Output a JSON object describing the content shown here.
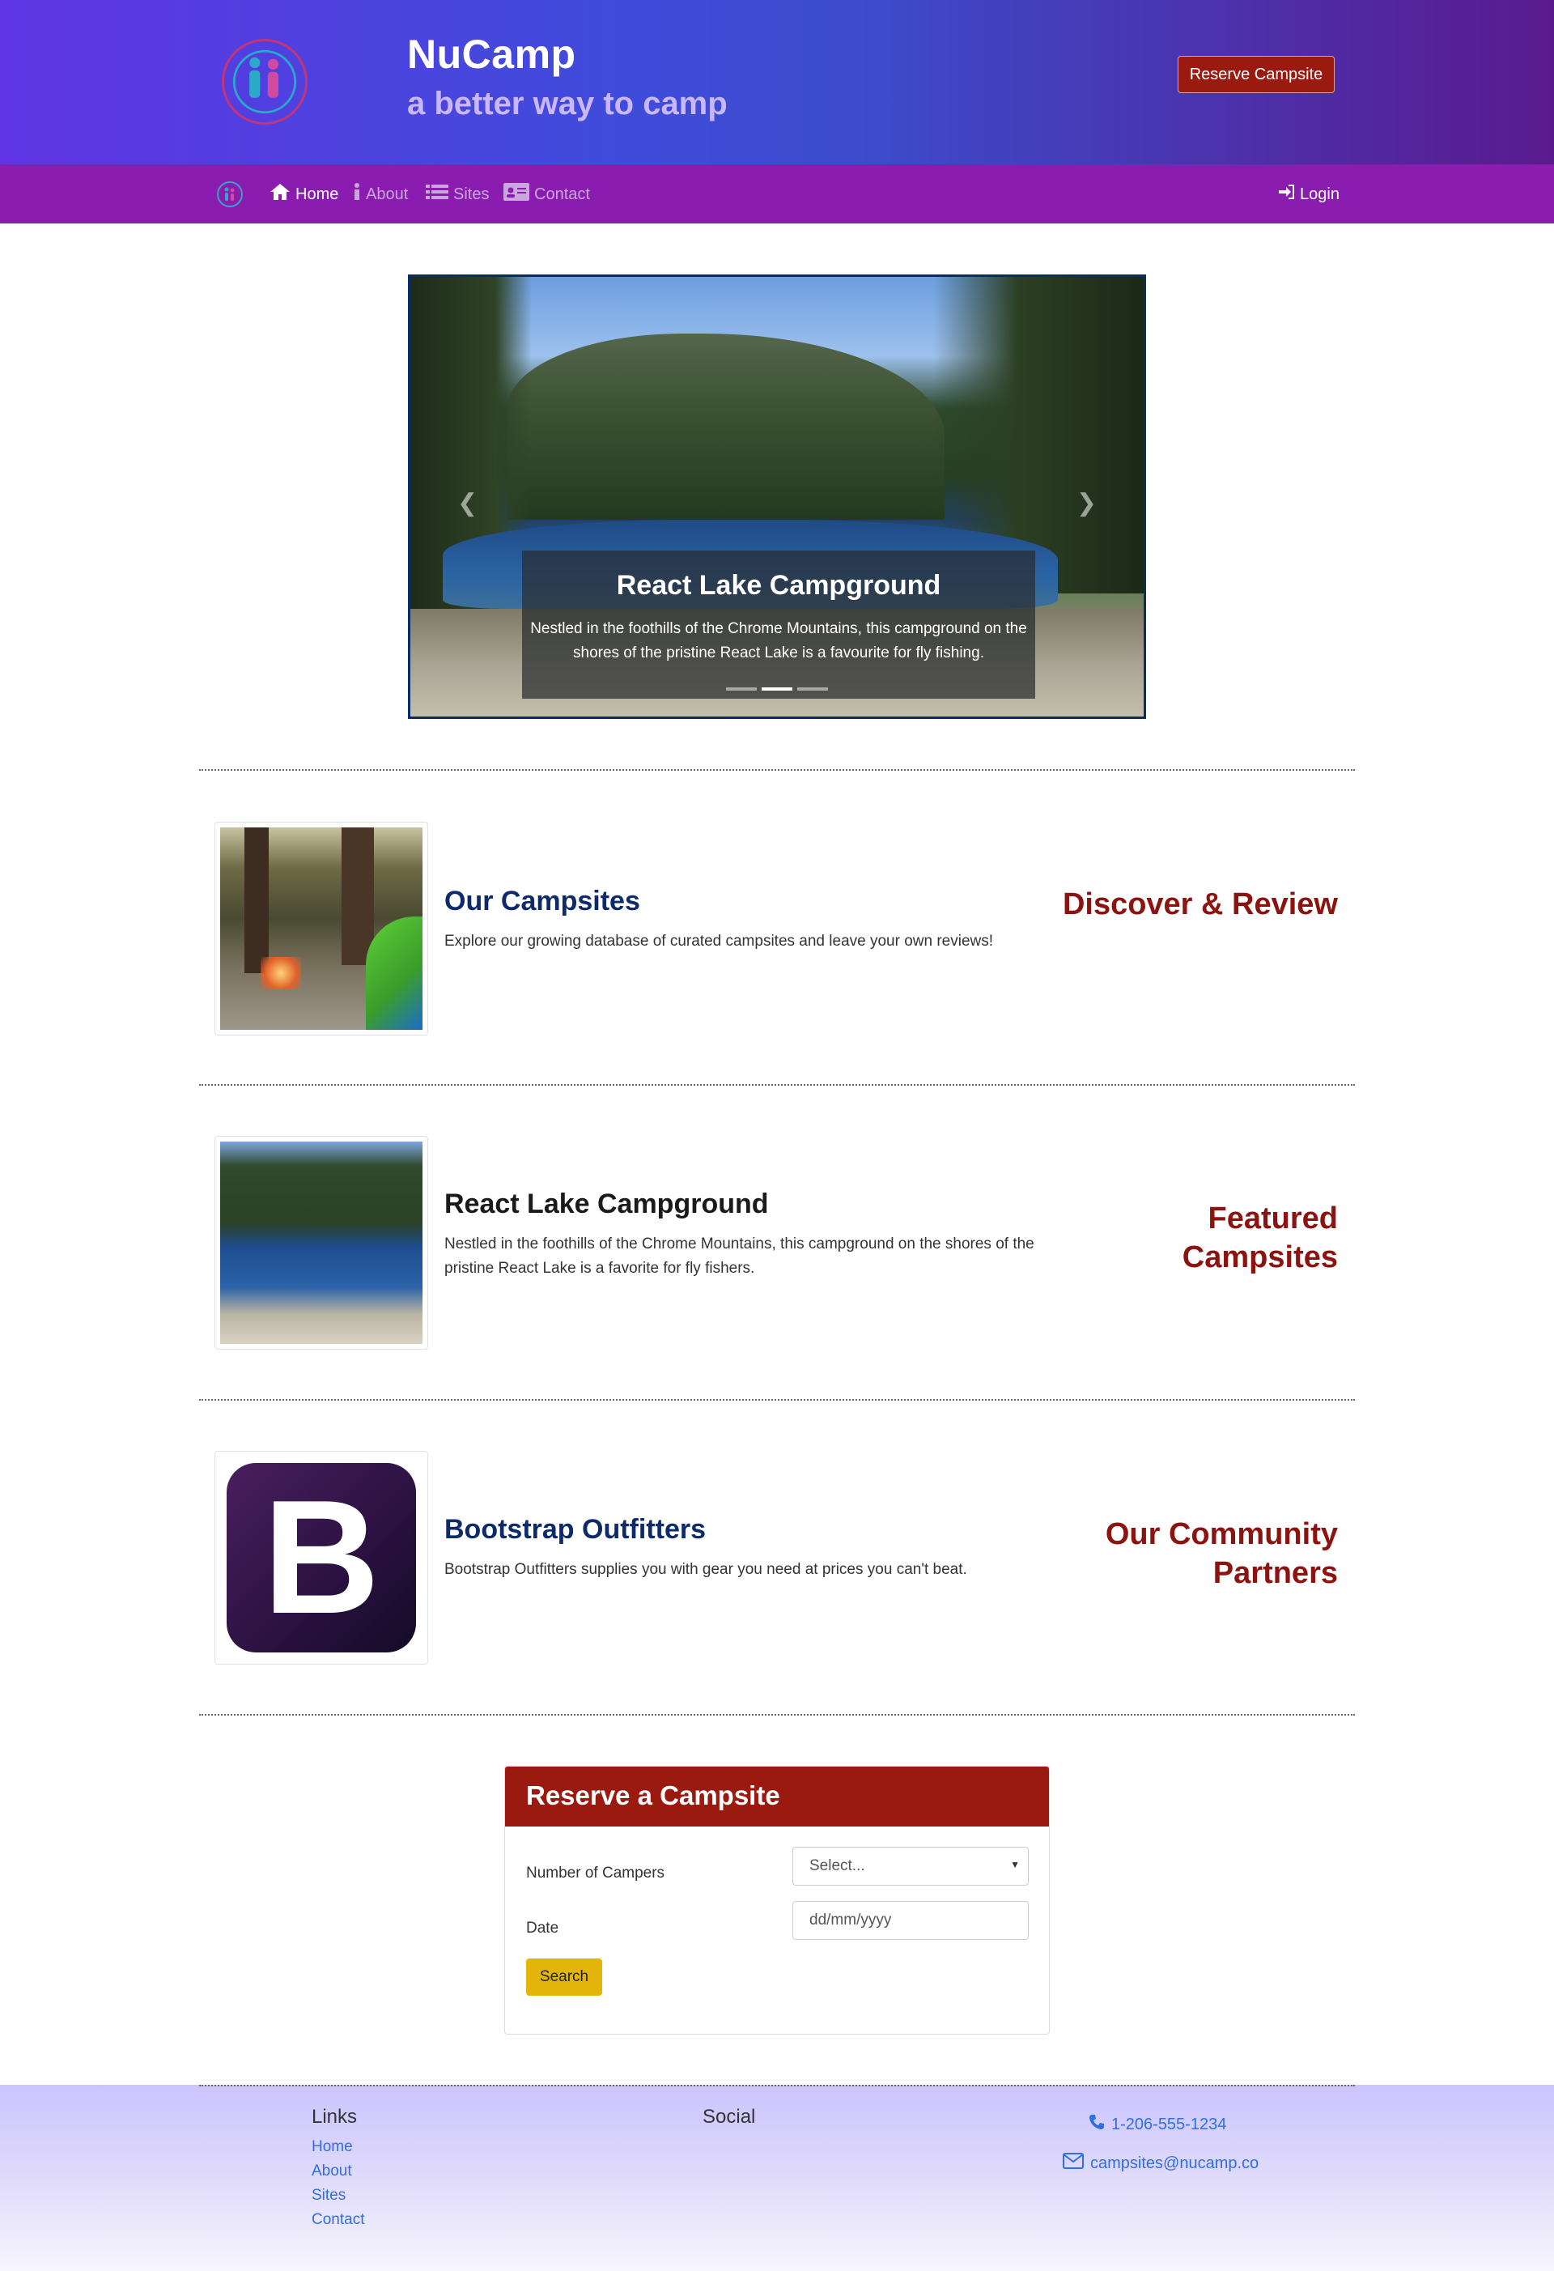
{
  "header": {
    "title": "NuCamp",
    "subtitle": "a better way to camp",
    "reserve_button": "Reserve Campsite"
  },
  "nav": {
    "items": [
      {
        "label": "Home",
        "icon": "home-icon",
        "active": true
      },
      {
        "label": "About",
        "icon": "info-icon",
        "active": false
      },
      {
        "label": "Sites",
        "icon": "list-icon",
        "active": false
      },
      {
        "label": "Contact",
        "icon": "address-card-icon",
        "active": false
      }
    ],
    "login": "Login"
  },
  "carousel": {
    "caption_title": "React Lake Campground",
    "caption_text": "Nestled in the foothills of the Chrome Mountains, this campground on the shores of the pristine React Lake is a favourite for fly fishing.",
    "active_slide": 2,
    "slide_count": 3
  },
  "sections": [
    {
      "title": "Our Campsites",
      "text": "Explore our growing database of curated campsites and leave your own reviews!",
      "label": "Discover & Review"
    },
    {
      "title": "React Lake Campground",
      "text": "Nestled in the foothills of the Chrome Mountains, this campground on the shores of the pristine React Lake is a favorite for fly fishers.",
      "label": "Featured Campsites"
    },
    {
      "title": "Bootstrap Outfitters",
      "text": "Bootstrap Outfitters supplies you with gear you need at prices you can't beat.",
      "label": "Our Community Partners",
      "logo_letter": "B"
    }
  ],
  "reserve_form": {
    "title": "Reserve a Campsite",
    "campers_label": "Number of Campers",
    "campers_value": "Select...",
    "date_label": "Date",
    "date_placeholder": "dd/mm/yyyy",
    "search_button": "Search"
  },
  "footer": {
    "links_heading": "Links",
    "links": [
      "Home",
      "About",
      "Sites",
      "Contact"
    ],
    "social_heading": "Social",
    "phone": "1-206-555-1234",
    "email": "campsites@nucamp.co"
  },
  "colors": {
    "nav_bg": "#8b1cb0",
    "accent_red": "#9a1a10",
    "title_blue": "#0d2a6b",
    "link_blue": "#2f6fe0",
    "search_yellow": "#e3b50a"
  }
}
